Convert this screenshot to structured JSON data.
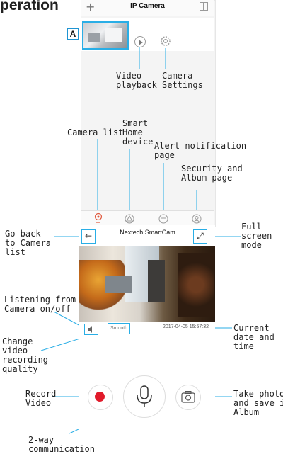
{
  "page": {
    "heading": "peration"
  },
  "camera_list_screen": {
    "title": "IP Camera",
    "add_icon": "+",
    "grid_icon": "grid-icon",
    "marker": "A",
    "nav_icons": [
      "camera-list-icon",
      "smart-home-icon",
      "alert-icon",
      "security-album-icon"
    ]
  },
  "live_view_screen": {
    "title": "Nextech SmartCam",
    "back_icon": "←",
    "fullscreen_icon": "⤢",
    "speaker_icon": "speaker-icon",
    "quality_label": "Smooth",
    "timestamp": "2017-04-05 15:57:32"
  },
  "annotations": {
    "video_playback": [
      "Video",
      "playback"
    ],
    "camera_settings": [
      "Camera",
      "Settings"
    ],
    "camera_list": [
      "Camera list"
    ],
    "smart_home": [
      "Smart",
      "Home",
      "device"
    ],
    "alert_page": [
      "Alert notification",
      "page"
    ],
    "security_album": [
      "Security and",
      "Album page"
    ],
    "go_back": [
      "Go back",
      "to Camera",
      "list"
    ],
    "full_screen": [
      "Full",
      "screen",
      "mode"
    ],
    "listening": [
      "Listening from",
      "Camera on/off"
    ],
    "change_quality": [
      "Change",
      "video",
      "recording",
      "quality"
    ],
    "current_date": [
      "Current",
      "date and",
      "time"
    ],
    "record_video": [
      "Record",
      "Video"
    ],
    "take_photo": [
      "Take photo",
      "and save in",
      "Album"
    ],
    "two_way": [
      "2-way",
      "communication"
    ]
  },
  "colors": {
    "accent": "#29aee6",
    "record": "#e11b2b"
  }
}
